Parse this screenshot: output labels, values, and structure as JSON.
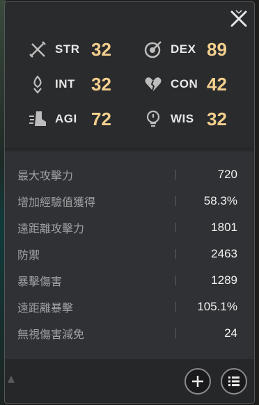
{
  "attributes": [
    {
      "key": "str",
      "label": "STR",
      "value": "32",
      "icon": "sword-icon"
    },
    {
      "key": "dex",
      "label": "DEX",
      "value": "89",
      "icon": "target-icon"
    },
    {
      "key": "int",
      "label": "INT",
      "value": "32",
      "icon": "flame-icon"
    },
    {
      "key": "con",
      "label": "CON",
      "value": "42",
      "icon": "heart-icon"
    },
    {
      "key": "agi",
      "label": "AGI",
      "value": "72",
      "icon": "boot-icon"
    },
    {
      "key": "wis",
      "label": "WIS",
      "value": "32",
      "icon": "bulb-icon"
    }
  ],
  "stats": [
    {
      "name": "最大攻擊力",
      "value": "720"
    },
    {
      "name": "增加經驗值獲得",
      "value": "58.3%"
    },
    {
      "name": "遠距離攻擊力",
      "value": "1801"
    },
    {
      "name": "防禦",
      "value": "2463"
    },
    {
      "name": "暴擊傷害",
      "value": "1289"
    },
    {
      "name": "遠距離暴擊",
      "value": "105.1%"
    },
    {
      "name": "無視傷害減免",
      "value": "24"
    }
  ],
  "colors": {
    "attr_value": "#f3cf8e",
    "stat_label": "#9fa0a3",
    "stat_value": "#f4f4f4"
  },
  "footer": {
    "add_icon": "plus-icon",
    "list_icon": "list-icon"
  }
}
